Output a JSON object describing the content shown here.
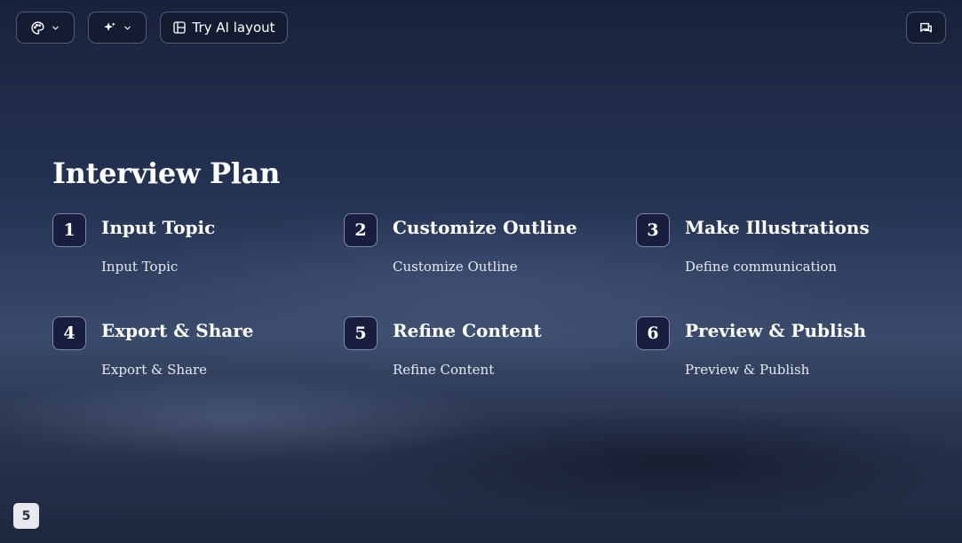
{
  "toolbar": {
    "palette_icon": "palette-icon",
    "magic_icon": "sparkles-icon",
    "chevron_icon": "chevron-down-icon",
    "ai_layout_icon": "layout-icon",
    "ai_layout_label": "Try AI layout",
    "comment_icon": "comment-icon"
  },
  "slide": {
    "title": "Interview Plan",
    "steps": [
      {
        "number": "1",
        "title": "Input Topic",
        "description": "Input Topic"
      },
      {
        "number": "2",
        "title": "Customize Outline",
        "description": "Customize Outline"
      },
      {
        "number": "3",
        "title": "Make Illustrations",
        "description": "Define communication"
      },
      {
        "number": "4",
        "title": "Export & Share",
        "description": "Export & Share"
      },
      {
        "number": "5",
        "title": "Refine Content",
        "description": "Refine Content"
      },
      {
        "number": "6",
        "title": "Preview & Publish",
        "description": "Preview & Publish"
      }
    ]
  },
  "page_number": "5",
  "colors": {
    "background_top": "#18223c",
    "background_mid": "#3a4a6a",
    "number_box": "#1a1e3e",
    "text": "#ffffff"
  }
}
